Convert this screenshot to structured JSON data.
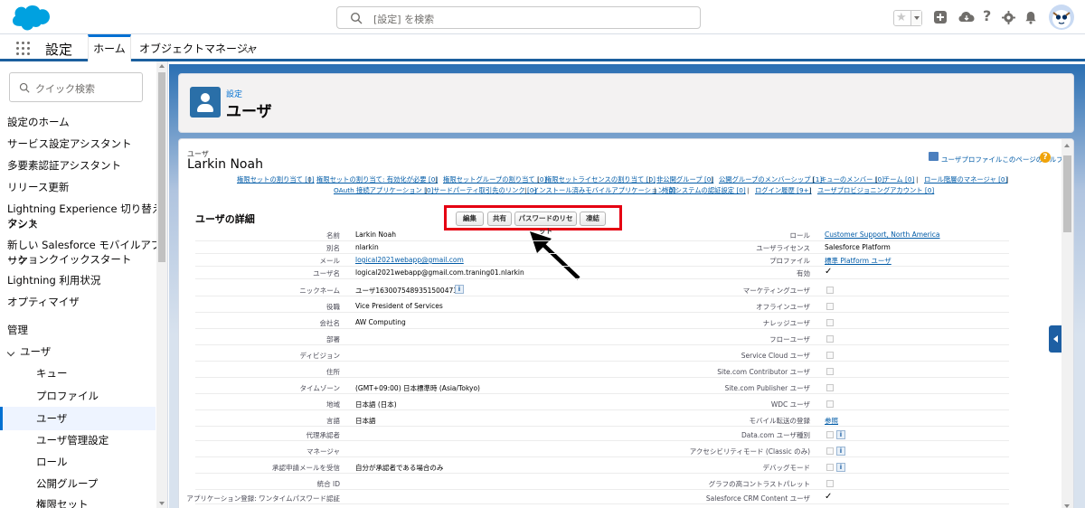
{
  "header": {
    "search_placeholder": "[設定] を検索"
  },
  "nav": {
    "app_name": "設定",
    "tabs": [
      {
        "label": "ホーム"
      },
      {
        "label": "オブジェクトマネージャ"
      }
    ]
  },
  "sidebar": {
    "quick_find_placeholder": "クイック検索",
    "items": [
      "設定のホーム",
      "サービス設定アシスタント",
      "多要素認証アシスタント",
      "リリース更新",
      "Lightning Experience 切り替えアシス",
      "タント",
      "新しい Salesforce モバイルアプリケ",
      "ーションクイックスタート",
      "Lightning 利用状況",
      "オプティマイザ"
    ],
    "section_admin": "管理",
    "users_group": "ユーザ",
    "sub_items": [
      "キュー",
      "プロファイル",
      "ユーザ",
      "ユーザ管理設定",
      "ロール",
      "公開グループ",
      "権限セット"
    ],
    "active_sub": "ユーザ"
  },
  "page": {
    "breadcrumb": "設定",
    "title": "ユーザ",
    "object_type": "ユーザ",
    "record_name": "Larkin Noah",
    "help_link": "ユーザプロファイルこのページのヘルプ",
    "help_icon": "?"
  },
  "related_links": [
    "権限セットの割り当て [0]",
    "権限セットの割り当て: 有効化が必要 [0]",
    "権限セットグループの割り当て [0]",
    "権限セットライセンスの割り当て [0]",
    "非公開グループ [0]",
    "公開グループのメンバーシップ [1]",
    "キューのメンバー [0]",
    "チーム [0]",
    "ロール階層のマネージャ [0]",
    "OAuth 接続アプリケーション [0]",
    "サードパーティ取引先のリンク [0]",
    "インストール済みモバイルアプリケーション [0]",
    "外部システムの認証設定 [0]",
    "ログイン履歴 [9+]",
    "ユーザプロビジョニングアカウント [0]"
  ],
  "detail": {
    "section_title": "ユーザの詳細",
    "buttons": [
      "編集",
      "共有",
      "パスワードのリセット",
      "凍結"
    ],
    "left_fields": [
      {
        "label": "名前",
        "value": "Larkin Noah"
      },
      {
        "label": "別名",
        "value": "nlarkin"
      },
      {
        "label": "メール",
        "value": "logical2021webapp@gmail.com"
      },
      {
        "label": "ユーザ名",
        "value": "logical2021webapp@gmail.com.traning01.nlarkin"
      },
      {
        "label": "ニックネーム",
        "value": "ユーザ16300754893515004733"
      },
      {
        "label": "役職",
        "value": "Vice President of Services"
      },
      {
        "label": "会社名",
        "value": "AW Computing"
      },
      {
        "label": "部署",
        "value": ""
      },
      {
        "label": "ディビジョン",
        "value": ""
      },
      {
        "label": "住所",
        "value": ""
      },
      {
        "label": "タイムゾーン",
        "value": "(GMT+09:00) 日本標準時 (Asia/Tokyo)"
      },
      {
        "label": "地域",
        "value": "日本語 (日本)"
      },
      {
        "label": "言語",
        "value": "日本語"
      },
      {
        "label": "代理承認者",
        "value": ""
      },
      {
        "label": "マネージャ",
        "value": ""
      },
      {
        "label": "承認申請メールを受信",
        "value": "自分が承認者である場合のみ"
      },
      {
        "label": "統合 ID",
        "value": ""
      },
      {
        "label": "アプリケーション登録: ワンタイムパスワード認証",
        "value": ""
      }
    ],
    "right_fields": [
      {
        "label": "ロール",
        "value": "Customer Support, North America"
      },
      {
        "label": "ユーザライセンス",
        "value": "Salesforce Platform"
      },
      {
        "label": "プロファイル",
        "value": "標準 Platform ユーザ"
      },
      {
        "label": "有効",
        "value": "✓"
      },
      {
        "label": "マーケティングユーザ",
        "value": ""
      },
      {
        "label": "オフラインユーザ",
        "value": ""
      },
      {
        "label": "ナレッジユーザ",
        "value": ""
      },
      {
        "label": "フローユーザ",
        "value": ""
      },
      {
        "label": "Service Cloud ユーザ",
        "value": ""
      },
      {
        "label": "Site.com Contributor ユーザ",
        "value": ""
      },
      {
        "label": "Site.com Publisher ユーザ",
        "value": ""
      },
      {
        "label": "WDC ユーザ",
        "value": ""
      },
      {
        "label": "モバイル転送の登録",
        "value": "参照"
      },
      {
        "label": "Data.com ユーザ種別",
        "value": ""
      },
      {
        "label": "アクセシビリティモード (Classic のみ)",
        "value": ""
      },
      {
        "label": "デバッグモード",
        "value": ""
      },
      {
        "label": "グラフの高コントラストパレット",
        "value": ""
      },
      {
        "label": "Salesforce CRM Content ユーザ",
        "value": "✓"
      }
    ]
  },
  "colors": {
    "brand": "#00a1e0",
    "highlight_box": "#e50012",
    "link": "#015ba7"
  }
}
